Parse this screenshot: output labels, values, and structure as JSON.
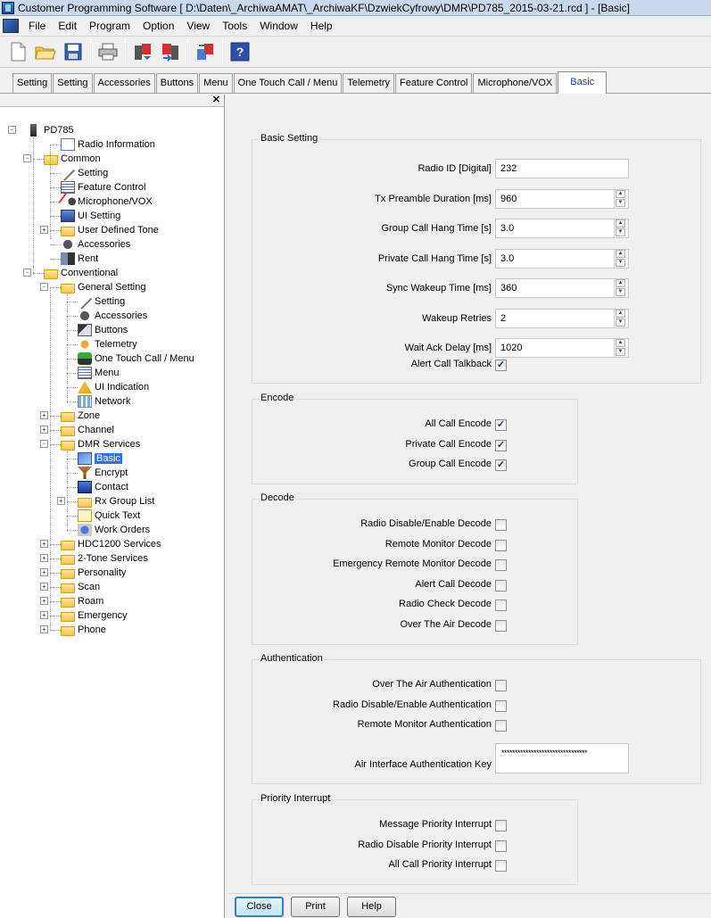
{
  "window": {
    "title": "Customer Programming Software [ D:\\Daten\\_ArchiwaAMAT\\_ArchiwaKF\\DzwiekCyfrowy\\DMR\\PD785_2015-03-21.rcd ] - [Basic]"
  },
  "menu": [
    "File",
    "Edit",
    "Program",
    "Option",
    "View",
    "Tools",
    "Window",
    "Help"
  ],
  "toolbar_icons": [
    "new-file-icon",
    "open-folder-icon",
    "save-icon",
    "print-icon",
    "read-radio-icon",
    "write-radio-icon",
    "clone-icon",
    "help-icon"
  ],
  "tabs": [
    "Setting",
    "Setting",
    "Accessories",
    "Buttons",
    "Menu",
    "One Touch Call / Menu",
    "Telemetry",
    "Feature Control",
    "Microphone/VOX",
    "Basic"
  ],
  "tree": {
    "close_glyph": "✕",
    "nodes": [
      {
        "label": "PD785",
        "icon": "radio-icon"
      },
      {
        "label": "Radio Information",
        "icon": "document-icon"
      },
      {
        "label": "Common",
        "icon": "folder-icon"
      },
      {
        "label": "Setting",
        "icon": "wrench-icon"
      },
      {
        "label": "Feature Control",
        "icon": "list-icon"
      },
      {
        "label": "Microphone/VOX",
        "icon": "microphone-icon"
      },
      {
        "label": "UI Setting",
        "icon": "ui-icon"
      },
      {
        "label": "User Defined Tone",
        "icon": "folder-icon"
      },
      {
        "label": "Accessories",
        "icon": "accessories-icon"
      },
      {
        "label": "Rent",
        "icon": "rent-icon"
      },
      {
        "label": "Conventional",
        "icon": "folder-icon"
      },
      {
        "label": "General Setting",
        "icon": "folder-icon"
      },
      {
        "label": "Setting",
        "icon": "wrench-icon"
      },
      {
        "label": "Accessories",
        "icon": "accessories-icon"
      },
      {
        "label": "Buttons",
        "icon": "cursor-icon"
      },
      {
        "label": "Telemetry",
        "icon": "telemetry-icon"
      },
      {
        "label": "One Touch Call / Menu",
        "icon": "phone-icon"
      },
      {
        "label": "Menu",
        "icon": "list-icon"
      },
      {
        "label": "UI Indication",
        "icon": "warning-icon"
      },
      {
        "label": "Network",
        "icon": "network-icon"
      },
      {
        "label": "Zone",
        "icon": "folder-icon"
      },
      {
        "label": "Channel",
        "icon": "folder-icon"
      },
      {
        "label": "DMR Services",
        "icon": "folder-icon"
      },
      {
        "label": "Basic",
        "icon": "basic-icon"
      },
      {
        "label": "Encrypt",
        "icon": "encrypt-icon"
      },
      {
        "label": "Contact",
        "icon": "contact-icon"
      },
      {
        "label": "Rx Group List",
        "icon": "folder-icon"
      },
      {
        "label": "Quick Text",
        "icon": "envelope-icon"
      },
      {
        "label": "Work Orders",
        "icon": "work-orders-icon"
      },
      {
        "label": "HDC1200 Services",
        "icon": "folder-icon"
      },
      {
        "label": "2-Tone Services",
        "icon": "folder-icon"
      },
      {
        "label": "Personality",
        "icon": "folder-icon"
      },
      {
        "label": "Scan",
        "icon": "folder-icon"
      },
      {
        "label": "Roam",
        "icon": "folder-icon"
      },
      {
        "label": "Emergency",
        "icon": "folder-icon"
      },
      {
        "label": "Phone",
        "icon": "folder-icon"
      }
    ],
    "selected": "Basic"
  },
  "basic_setting": {
    "title": "Basic Setting",
    "fields": [
      {
        "label": "Radio ID [Digital]",
        "value": "232",
        "spinner": false
      },
      {
        "label": "Tx Preamble Duration [ms]",
        "value": "960",
        "spinner": true
      },
      {
        "label": "Group Call Hang Time [s]",
        "value": "3.0",
        "spinner": true
      },
      {
        "label": "Private Call Hang Time [s]",
        "value": "3.0",
        "spinner": true
      },
      {
        "label": "Sync Wakeup Time [ms]",
        "value": "360",
        "spinner": true
      },
      {
        "label": "Wakeup Retries",
        "value": "2",
        "spinner": true
      },
      {
        "label": "Wait Ack Delay [ms]",
        "value": "1020",
        "spinner": true
      }
    ],
    "alert_call_talkback": {
      "label": "Alert Call Talkback",
      "checked": true
    }
  },
  "encode": {
    "title": "Encode",
    "items": [
      {
        "label": "All Call Encode",
        "checked": true
      },
      {
        "label": "Private Call Encode",
        "checked": true
      },
      {
        "label": "Group Call Encode",
        "checked": true
      }
    ]
  },
  "decode": {
    "title": "Decode",
    "items": [
      {
        "label": "Radio Disable/Enable Decode",
        "checked": false
      },
      {
        "label": "Remote Monitor Decode",
        "checked": false
      },
      {
        "label": "Emergency Remote Monitor Decode",
        "checked": false
      },
      {
        "label": "Alert Call Decode",
        "checked": false
      },
      {
        "label": "Radio Check Decode",
        "checked": false
      },
      {
        "label": "Over The Air Decode",
        "checked": false
      }
    ]
  },
  "authentication": {
    "title": "Authentication",
    "items": [
      {
        "label": "Over The Air Authentication",
        "checked": false
      },
      {
        "label": "Radio Disable/Enable Authentication",
        "checked": false
      },
      {
        "label": "Remote Monitor Authentication",
        "checked": false
      }
    ],
    "key_label": "Air Interface Authentication Key",
    "key_value": "********************************"
  },
  "priority_interrupt": {
    "title": "Priority Interrupt",
    "items": [
      {
        "label": "Message Priority Interrupt",
        "checked": false
      },
      {
        "label": "Radio Disable Priority Interrupt",
        "checked": false
      },
      {
        "label": "All Call Priority Interrupt",
        "checked": false
      }
    ]
  },
  "buttons": {
    "close": "Close",
    "print": "Print",
    "help": "Help"
  },
  "check_glyph": "✓",
  "spin_up": "▲",
  "spin_down": "▼"
}
